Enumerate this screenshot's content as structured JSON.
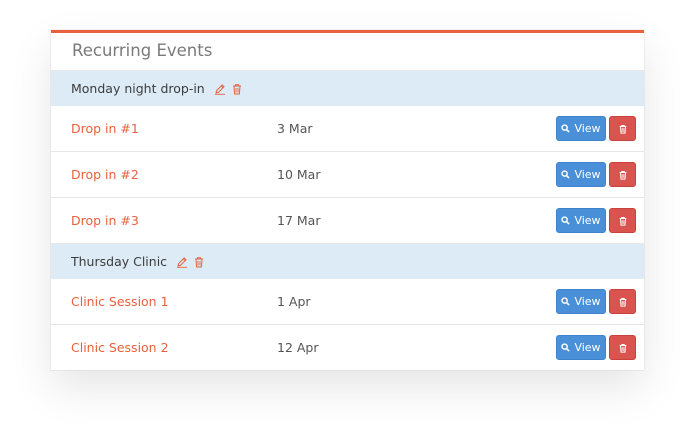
{
  "panel": {
    "title": "Recurring Events"
  },
  "groups": [
    {
      "name": "Monday night drop-in",
      "events": [
        {
          "name": "Drop in #1",
          "date": "3 Mar"
        },
        {
          "name": "Drop in #2",
          "date": "10 Mar"
        },
        {
          "name": "Drop in #3",
          "date": "17 Mar"
        }
      ]
    },
    {
      "name": "Thursday Clinic",
      "events": [
        {
          "name": "Clinic Session 1",
          "date": "1 Apr"
        },
        {
          "name": "Clinic Session 2",
          "date": "12 Apr"
        }
      ]
    }
  ],
  "actions": {
    "view_label": "View"
  },
  "icons": {
    "edit": "pencil-icon",
    "delete": "trash-icon",
    "view": "search-icon"
  },
  "colors": {
    "accent": "#e8613c",
    "group_bg": "#dcebf6",
    "view_btn": "#4a90d9",
    "delete_btn": "#d9534f"
  }
}
